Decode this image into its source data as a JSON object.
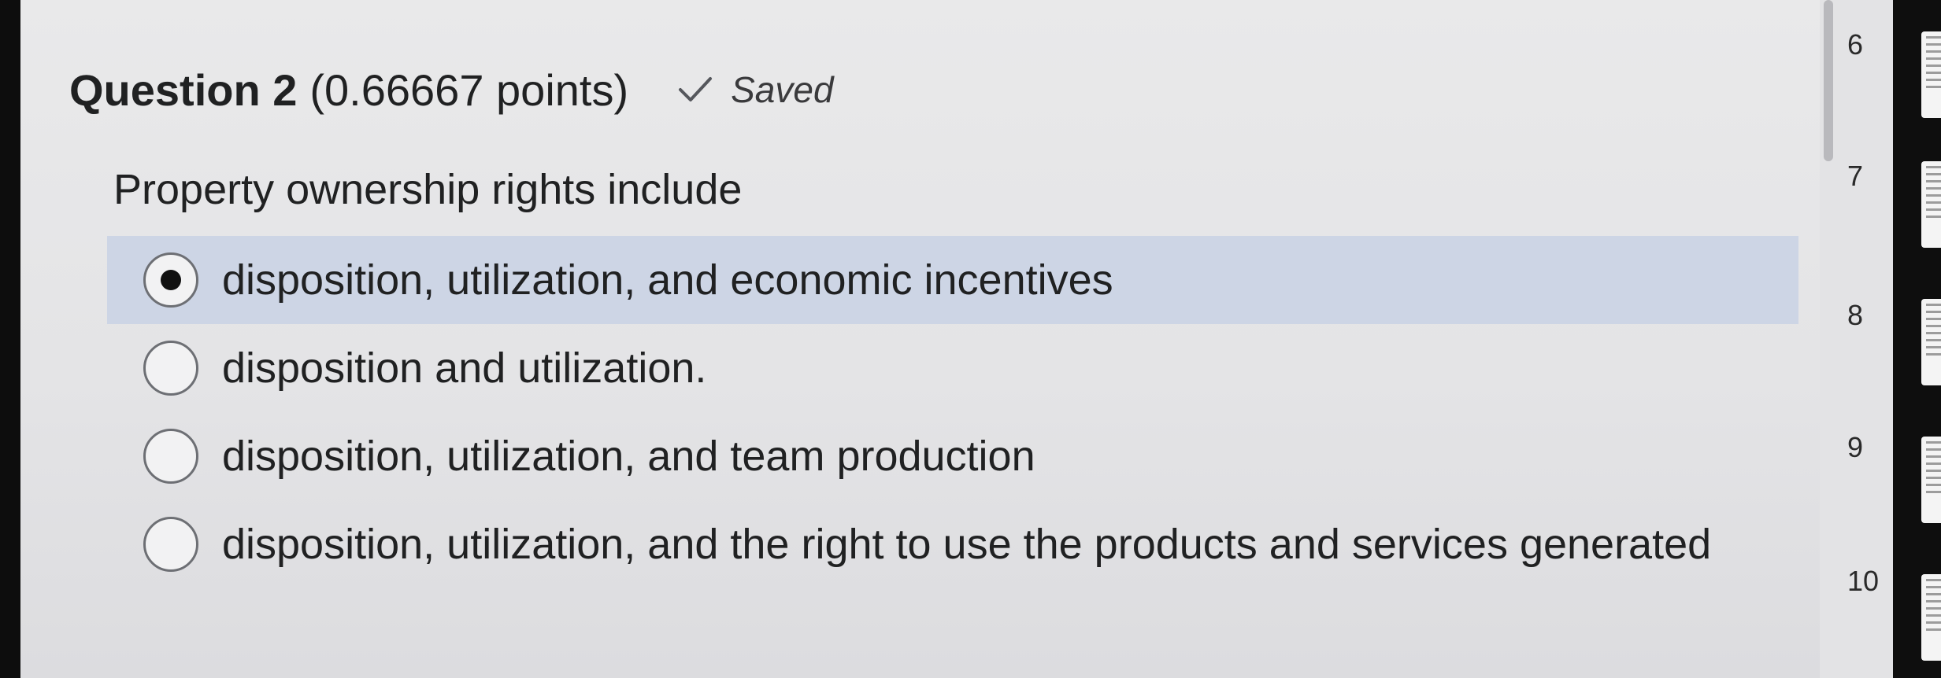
{
  "question": {
    "title": "Question 2",
    "points": "(0.66667 points)",
    "status": "Saved",
    "text": "Property ownership rights include"
  },
  "options": [
    {
      "label": "disposition, utilization, and economic incentives",
      "selected": true
    },
    {
      "label": "disposition and utilization.",
      "selected": false
    },
    {
      "label": "disposition, utilization, and team production",
      "selected": false
    },
    {
      "label": "disposition, utilization, and the right to use the products and services generated",
      "selected": false
    }
  ],
  "question_nav": [
    "6",
    "7",
    "8",
    "9",
    "10"
  ],
  "icons": {
    "saved": "checkmark-icon"
  },
  "colors": {
    "selected_highlight": "#cdd5e5",
    "text": "#202122"
  }
}
